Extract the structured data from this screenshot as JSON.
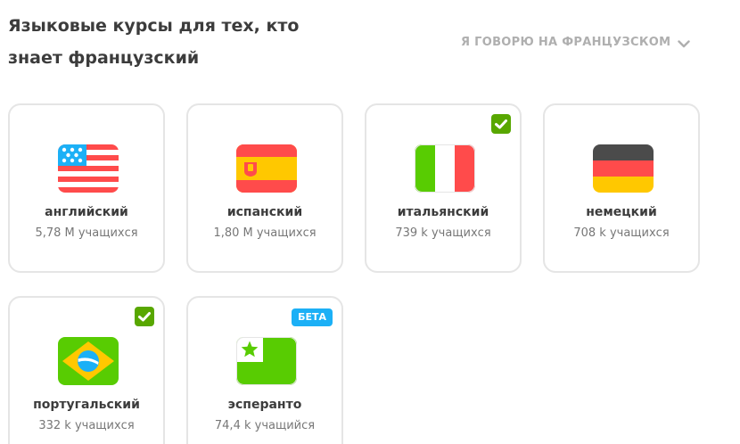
{
  "header": {
    "title": "Языковые курсы для тех, кто знает французский",
    "language_dropdown": "Я ГОВОРЮ НА ФРАНЦУЗСКОМ"
  },
  "colors": {
    "accent_green": "#58a700",
    "beta_blue": "#1cb0f6",
    "card_border": "#e5e5e5",
    "title_text": "#3c3c3c",
    "muted_text": "#777777"
  },
  "courses": [
    {
      "name": "английский",
      "learners": "5,78 M учащихся",
      "flag_icon": "usa-flag-icon",
      "selected": false
    },
    {
      "name": "испанский",
      "learners": "1,80 M учащихся",
      "flag_icon": "spain-flag-icon",
      "selected": false
    },
    {
      "name": "итальянский",
      "learners": "739 k учащихся",
      "flag_icon": "italy-flag-icon",
      "selected": true
    },
    {
      "name": "немецкий",
      "learners": "708 k учащихся",
      "flag_icon": "germany-flag-icon",
      "selected": false
    },
    {
      "name": "португальский",
      "learners": "332 k учащихся",
      "flag_icon": "brazil-flag-icon",
      "selected": true
    },
    {
      "name": "эсперанто",
      "learners": "74,4 k учащийся",
      "flag_icon": "esperanto-flag-icon",
      "selected": false,
      "badge": "БЕТА"
    }
  ]
}
